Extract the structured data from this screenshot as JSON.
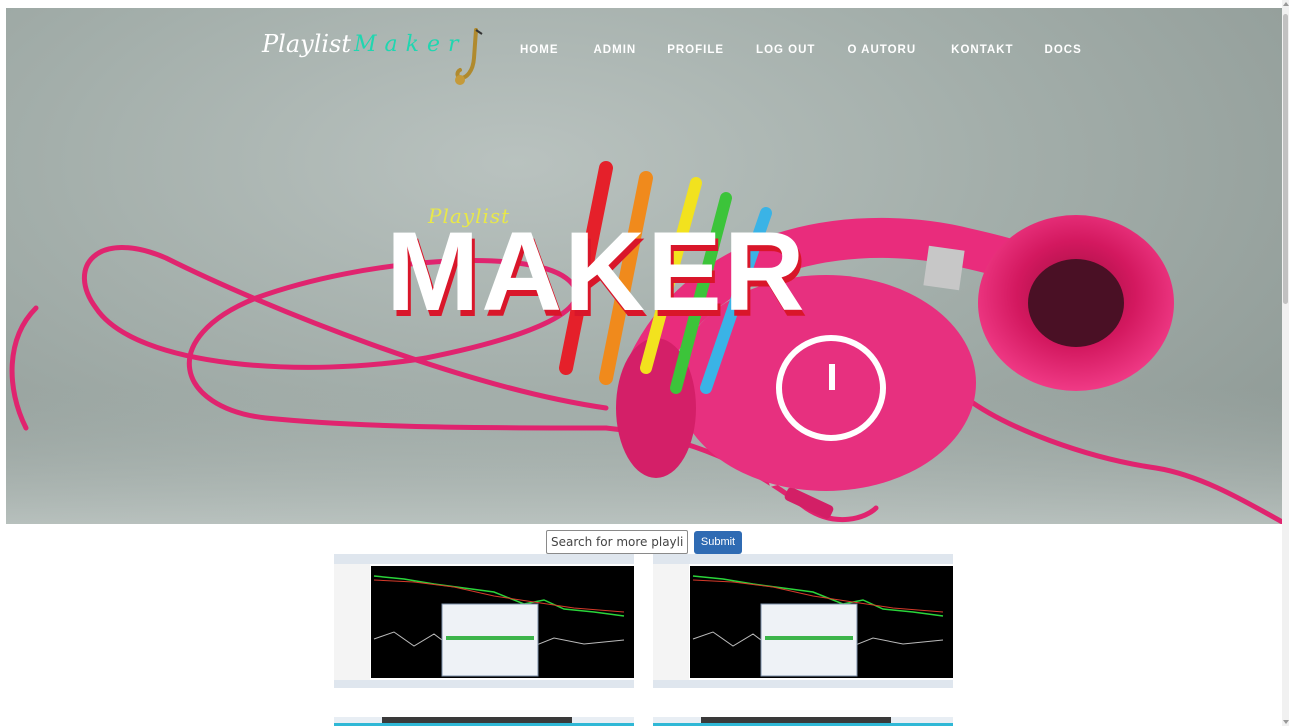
{
  "brand": {
    "part1": "Playlist",
    "part2": "Maker"
  },
  "nav": [
    "HOME",
    "ADMIN",
    "PROFILE",
    "LOG OUT",
    "O AUTORU",
    "KONTAKT",
    "DOCS"
  ],
  "hero": {
    "logo_small": "Playlist",
    "logo_big": "MAKER"
  },
  "search": {
    "placeholder": "Search for more playlists",
    "submit_label": "Submit"
  },
  "colors": {
    "accent": "#20d6b0",
    "submit": "#2f6bb3",
    "headphones": "#e8267a",
    "logo_shadow": "#d9162a"
  }
}
